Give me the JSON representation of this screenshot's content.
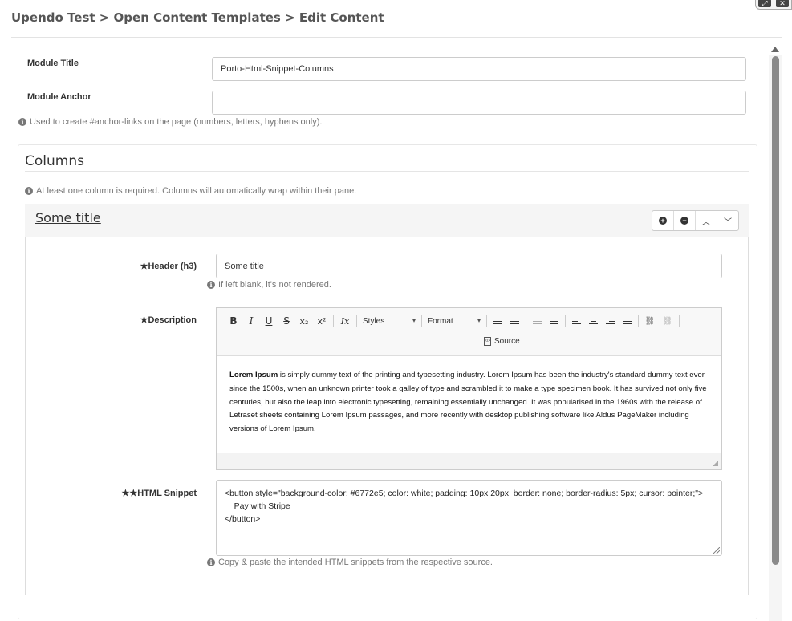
{
  "breadcrumb": {
    "text": "Upendo Test > Open Content Templates > Edit Content"
  },
  "module": {
    "title_label": "Module Title",
    "title_value": "Porto-Html-Snippet-Columns",
    "anchor_label": "Module Anchor",
    "anchor_value": "",
    "anchor_help": "Used to create #anchor-links on the page (numbers, letters, hyphens only)."
  },
  "columns": {
    "title": "Columns",
    "help": "At least one column is required. Columns will automatically wrap within their pane.",
    "item": {
      "title": "Some title",
      "header_label": "Header (h3)",
      "header_value": "Some title",
      "header_help": "If left blank, it's not rendered.",
      "description_label": "Description",
      "toolbar": {
        "bold": "B",
        "italic": "I",
        "underline": "U",
        "strike": "S",
        "subscript": "x₂",
        "superscript": "x²",
        "clear_format": "Ix",
        "styles": "Styles",
        "format": "Format",
        "source": "Source"
      },
      "description_bold": "Lorem Ipsum",
      "description_text": " is simply dummy text of the printing and typesetting industry. Lorem Ipsum has been the industry's standard dummy text ever since the 1500s, when an unknown printer took a galley of type and scrambled it to make a type specimen book. It has survived not only five centuries, but also the leap into electronic typesetting, remaining essentially unchanged. It was popularised in the 1960s with the release of Letraset sheets containing Lorem Ipsum passages, and more recently with desktop publishing software like Aldus PageMaker including versions of Lorem Ipsum.",
      "snippet_label": "HTML Snippet",
      "snippet_value": "<button style=\"background-color: #6772e5; color: white; padding: 10px 20px; border: none; border-radius: 5px; cursor: pointer;\">\n    Pay with Stripe\n</button>",
      "snippet_help": "Copy & paste the intended HTML snippets from the respective source."
    }
  },
  "required_marker": "★",
  "icons": {
    "info": "info-circle-icon",
    "add": "plus-circle-icon",
    "remove": "minus-circle-icon",
    "up": "chevron-up-icon",
    "down": "chevron-down-icon"
  }
}
